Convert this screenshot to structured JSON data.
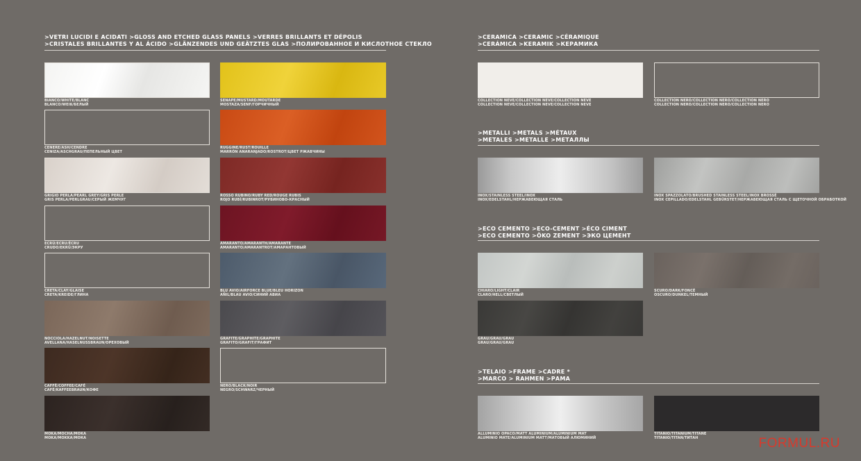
{
  "left": {
    "header": [
      ">VETRI LUCIDI E ACIDATI >GLOSS AND ETCHED GLASS PANELS >VERRES BRILLANTS ET DÉPOLIS",
      ">CRISTALES BRILLANTES Y AL ÁCIDO >GLÄNZENDES UND GEÄTZTES GLAS >ПОЛИРОВАННОЕ И КИСЛОТНОЕ СТЕКЛО"
    ],
    "col1": [
      {
        "l1": "BIANCO/WHITE/BLANC",
        "l2": "BLANCO/WEIß/БЕЛЫЙ"
      },
      {
        "l1": "CENERE/ASH/CENDRE",
        "l2": "CENIZA/ASCHGRAU/ПЕПЕЛЬНЫЙ ЦВЕТ"
      },
      {
        "l1": "GRIGIO PERLA/PEARL GREY/GRIS PERLE",
        "l2": "GRIS PERLA/PERLGRAU/СЕРЫЙ ЖЕМЧУГ"
      },
      {
        "l1": "ECRÙ/ECRU/ÉCRU",
        "l2": "CRUDO/EKRÜ/ЭКРУ"
      },
      {
        "l1": "CRETA/CLAY/GLAISE",
        "l2": "CRETA/KREIDE/ГЛИНА"
      },
      {
        "l1": "NOCCIOLA/HAZELNUT/NOISETTE",
        "l2": "AVELLANA/HASELNUSSBRAUN/ОРЕХОВЫЙ"
      },
      {
        "l1": "CAFFÈ/COFFEE/CAFÉ",
        "l2": "CAFÉ/KAFFEEBRAUN/КОФЕ"
      },
      {
        "l1": "MOKA/MOCHA/MOKA",
        "l2": "MOKA/MOKKA/МОКА"
      }
    ],
    "col2": [
      {
        "l1": "SENAPE/MUSTARD/MOUTARDE",
        "l2": "MOSTAZA/SENF/ГОРЧИЧНЫЙ"
      },
      {
        "l1": "RUGGINE/RUST/ROUILLE",
        "l2": "MARRÓN ANARANJADO/ROSTROT/ЦВЕТ РЖАВЧИНЫ"
      },
      {
        "l1": "ROSSO RUBINO/RUBY RED/ROUGE RUBIS",
        "l2": "ROJO RUBÍ/RUBINROT/РУБИНОВО-КРАСНЫЙ"
      },
      {
        "l1": "AMARANTO/AMARANTH/AMARANTE",
        "l2": "AMARANTO/AMARANTROT/АМАРАНТОВЫЙ"
      },
      {
        "l1": "BLU AVIO/AIRFORCE BLUE/BLEU HORIZON",
        "l2": "AÑIL/BLAU AVIO/СИНИЙ АВИА"
      },
      {
        "l1": "GRAFITE/GRAPHITE/GRAPHITE",
        "l2": "GRAFITO/GRAFIT/ГРАФИТ"
      },
      {
        "l1": "NERO/BLACK/NOIR",
        "l2": "NEGRO/SCHWARZ/ЧЕРНЫЙ"
      }
    ]
  },
  "right": {
    "ceramica": {
      "header": [
        ">CERAMICA >CERAMIC >CÉRAMIQUE",
        ">CERÁMICA >KERAMIK >КЕРАМИКА"
      ],
      "items": [
        {
          "l1": "COLLECTION NEVE/COLLECTION NEVE/COLLECTION NEVE",
          "l2": "COLLECTION NEVE/COLLECTION NEVE/COLLECTION NEVE"
        },
        {
          "l1": "COLLECTION NERO/COLLECTION NERO/COLLECTION NERO",
          "l2": "COLLECTION NERO/COLLECTION NERO/COLLECTION NERO"
        }
      ]
    },
    "metalli": {
      "header": [
        ">METALLI >METALS >MÉTAUX",
        ">METALES >METALLE >МЕТАЛЛЫ"
      ],
      "items": [
        {
          "l1": "INOX/STAINLESS STEEL/INOX",
          "l2": "INOX/EDELSTAHL/НЕРЖАВЕЮЩАЯ СТАЛЬ"
        },
        {
          "l1": "INOX SPAZZOLATO/BRUSHED STAINLESS STEEL/INOX BROSSÉ",
          "l2": "INOX CEPILLADO/EDELSTAHL GEBÜRSTET/НЕРЖАВЕЮЩАЯ СТАЛЬ С ЩЕТОЧНОЙ ОБРАБОТКОЙ"
        }
      ]
    },
    "eco": {
      "header": [
        ">ECO CEMENTO >ECO-CEMENT >ÉCO CIMENT",
        ">ECO CEMENTO >ÖKO ZEMENT >ЭКО ЦЕМЕНТ"
      ],
      "items": [
        {
          "l1": "CHIARO/LIGHT/CLAIR",
          "l2": "CLARO/HELL/СВЕТЛЫЙ"
        },
        {
          "l1": "SCURO/DARK/FONCÉ",
          "l2": "OSCURO/DUNKEL/ТЕМНЫЙ"
        },
        {
          "l1": "GRAU/GRAU/GRAU",
          "l2": "GRAU/GRAU/GRAU"
        }
      ]
    },
    "telaio": {
      "header": [
        ">TELAIO >FRAME >CADRE *",
        ">MARCO > RAHMEN >РАМА"
      ],
      "items": [
        {
          "l1": "ALLUMINIO OPACO/MATT ALUMINIUM/ALUMINIUM MAT",
          "l2": "ALUMINIO MATE/ALUMINIUM MATT/МАТОВЫЙ АЛЮМИНИЙ"
        },
        {
          "l1": "TITANIO/TITANIUM/TITANE",
          "l2": "TITANIO/TITAN/ТИТАН"
        }
      ]
    }
  },
  "watermark": "FORMUL.RU"
}
